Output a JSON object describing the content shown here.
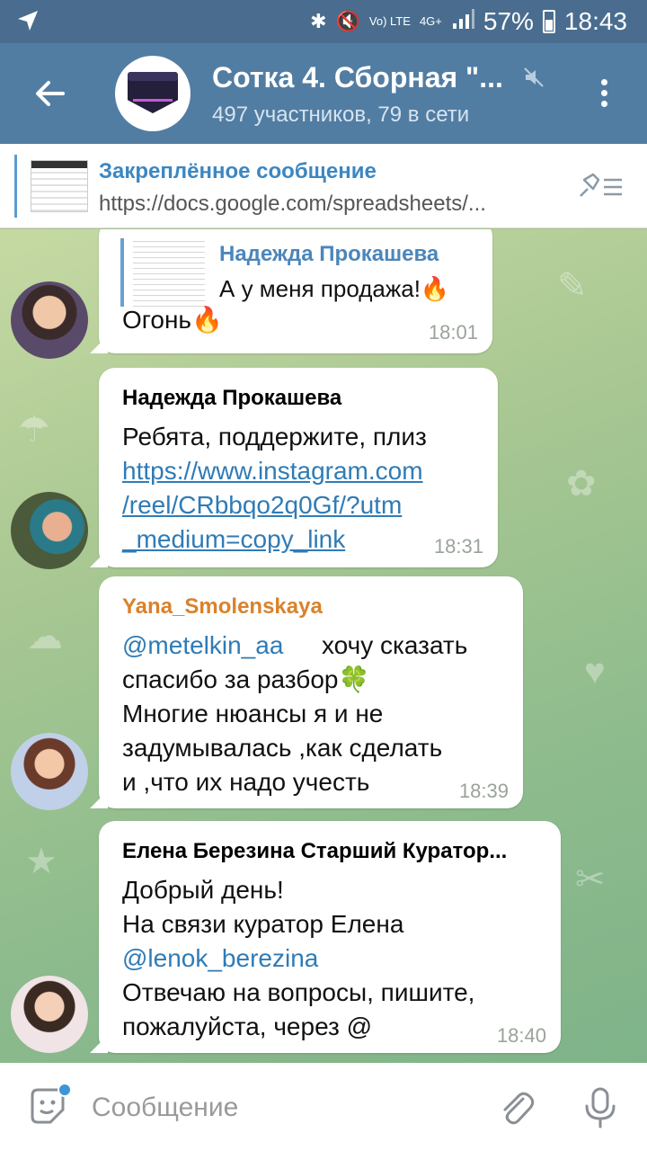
{
  "status_bar": {
    "network": "Vo) LTE",
    "network_type": "4G+",
    "battery": "57%",
    "time": "18:43"
  },
  "header": {
    "title": "Сотка 4. Сборная \"...",
    "subtitle": "497 участников, 79 в сети"
  },
  "pinned": {
    "title": "Закреплённое сообщение",
    "text": "https://docs.google.com/spreadsheets/..."
  },
  "messages": [
    {
      "reply_name": "Надежда Прокашева",
      "reply_text": "А у меня продажа!🔥",
      "text_lines": [
        "Огонь🔥"
      ],
      "time": "18:01"
    },
    {
      "sender": "Надежда Прокашева",
      "sender_color": "#4c86b9",
      "text_lines": [
        "Ребята, поддержите, плиз"
      ],
      "link_lines": [
        "https://www.instagram.com",
        "/reel/CRbbqo2q0Gf/?utm",
        "_medium=copy_link"
      ],
      "time": "18:31"
    },
    {
      "sender": "Yana_Smolenskaya",
      "sender_color": "#d9822b",
      "mention": "@metelkin_aa",
      "text_lines": [
        "хочу сказать",
        "спасибо за разбор🍀",
        "Многие нюансы я и не",
        "задумывалась ,как сделать",
        "и ,что их надо учесть"
      ],
      "time": "18:39"
    },
    {
      "sender": "Елена Березина Старший Куратор...",
      "sender_color": "#4c86b9",
      "text_lines": [
        "Добрый день!",
        "На связи куратор Елена"
      ],
      "mention": "@lenok_berezina",
      "text_lines_after": [
        "Отвечаю на вопросы, пишите,",
        "пожалуйста, через @"
      ],
      "time": "18:40"
    }
  ],
  "input": {
    "placeholder": "Сообщение"
  },
  "colors": {
    "header_bg": "#527da3",
    "status_bg": "#4a6d8f",
    "link": "#2f7bb6",
    "pinned_title": "#3c87c2"
  }
}
